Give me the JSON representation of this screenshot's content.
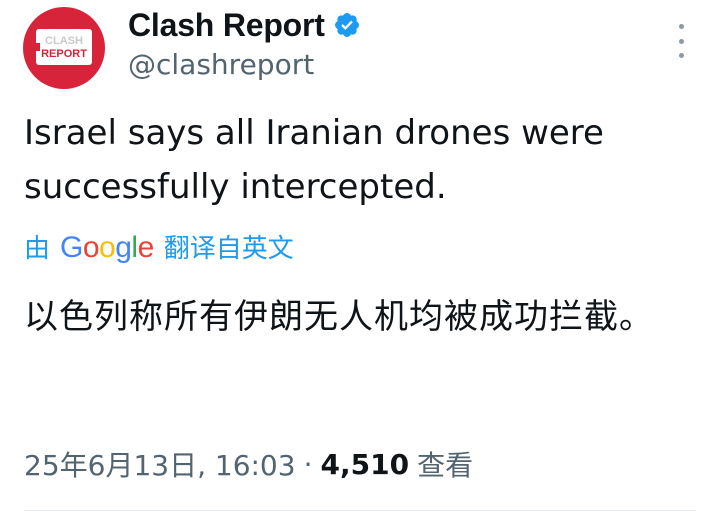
{
  "author": {
    "display_name": "Clash Report",
    "handle": "@clashreport",
    "avatar_text_top": "CLASH",
    "avatar_text_bottom": "REPORT",
    "avatar_color": "#d7243a",
    "verified": true,
    "verified_color": "#1d9bf0"
  },
  "menu": {
    "icon": "more-vertical-icon"
  },
  "tweet": {
    "text": "Israel says all Iranian drones were successfully intercepted."
  },
  "translation": {
    "prefix": "由",
    "provider": "Google",
    "suffix": "翻译自英文",
    "link_color": "#1d9bf0",
    "translated_text": "以色列称所有伊朗无人机均被成功拦截。"
  },
  "meta": {
    "date_time": "25年6月13日, 16:03",
    "separator": "·",
    "view_count": "4,510",
    "view_label": "查看"
  }
}
